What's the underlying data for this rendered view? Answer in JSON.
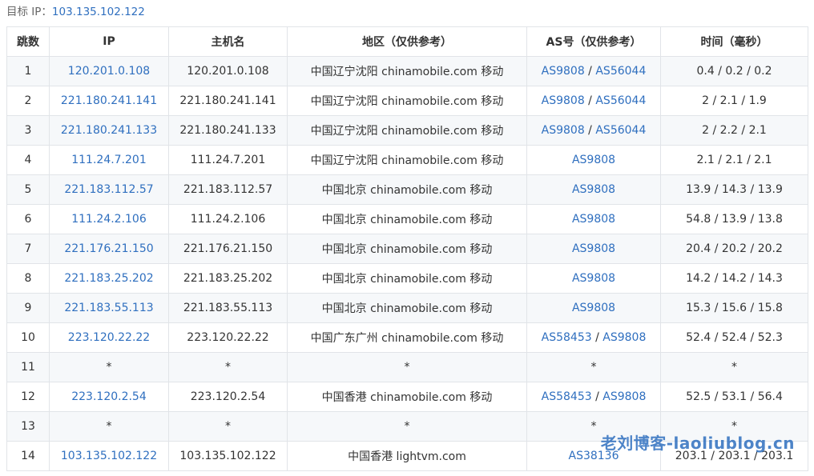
{
  "target": {
    "label": "目标 IP：",
    "ip": "103.135.102.122"
  },
  "table": {
    "headers": [
      "跳数",
      "IP",
      "主机名",
      "地区（仅供参考）",
      "AS号（仅供参考）",
      "时间（毫秒）"
    ],
    "rows": [
      {
        "hop": "1",
        "ip": "120.201.0.108",
        "host": "120.201.0.108",
        "region": "中国辽宁沈阳 chinamobile.com 移动",
        "as": [
          "AS9808",
          "AS56044"
        ],
        "time": "0.4 / 0.2 / 0.2"
      },
      {
        "hop": "2",
        "ip": "221.180.241.141",
        "host": "221.180.241.141",
        "region": "中国辽宁沈阳 chinamobile.com 移动",
        "as": [
          "AS9808",
          "AS56044"
        ],
        "time": "2 / 2.1 / 1.9"
      },
      {
        "hop": "3",
        "ip": "221.180.241.133",
        "host": "221.180.241.133",
        "region": "中国辽宁沈阳 chinamobile.com 移动",
        "as": [
          "AS9808",
          "AS56044"
        ],
        "time": "2 / 2.2 / 2.1"
      },
      {
        "hop": "4",
        "ip": "111.24.7.201",
        "host": "111.24.7.201",
        "region": "中国辽宁沈阳 chinamobile.com 移动",
        "as": [
          "AS9808"
        ],
        "time": "2.1 / 2.1 / 2.1"
      },
      {
        "hop": "5",
        "ip": "221.183.112.57",
        "host": "221.183.112.57",
        "region": "中国北京 chinamobile.com 移动",
        "as": [
          "AS9808"
        ],
        "time": "13.9 / 14.3 / 13.9"
      },
      {
        "hop": "6",
        "ip": "111.24.2.106",
        "host": "111.24.2.106",
        "region": "中国北京 chinamobile.com 移动",
        "as": [
          "AS9808"
        ],
        "time": "54.8 / 13.9 / 13.8"
      },
      {
        "hop": "7",
        "ip": "221.176.21.150",
        "host": "221.176.21.150",
        "region": "中国北京 chinamobile.com 移动",
        "as": [
          "AS9808"
        ],
        "time": "20.4 / 20.2 / 20.2"
      },
      {
        "hop": "8",
        "ip": "221.183.25.202",
        "host": "221.183.25.202",
        "region": "中国北京 chinamobile.com 移动",
        "as": [
          "AS9808"
        ],
        "time": "14.2 / 14.2 / 14.3"
      },
      {
        "hop": "9",
        "ip": "221.183.55.113",
        "host": "221.183.55.113",
        "region": "中国北京 chinamobile.com 移动",
        "as": [
          "AS9808"
        ],
        "time": "15.3 / 15.6 / 15.8"
      },
      {
        "hop": "10",
        "ip": "223.120.22.22",
        "host": "223.120.22.22",
        "region": "中国广东广州 chinamobile.com 移动",
        "as": [
          "AS58453",
          "AS9808"
        ],
        "time": "52.4 / 52.4 / 52.3"
      },
      {
        "hop": "11",
        "ip": "*",
        "host": "*",
        "region": "*",
        "as": [
          "*"
        ],
        "time": "*"
      },
      {
        "hop": "12",
        "ip": "223.120.2.54",
        "host": "223.120.2.54",
        "region": "中国香港 chinamobile.com 移动",
        "as": [
          "AS58453",
          "AS9808"
        ],
        "time": "52.5 / 53.1 / 56.4"
      },
      {
        "hop": "13",
        "ip": "*",
        "host": "*",
        "region": "*",
        "as": [
          "*"
        ],
        "time": "*"
      },
      {
        "hop": "14",
        "ip": "103.135.102.122",
        "host": "103.135.102.122",
        "region": "中国香港 lightvm.com",
        "as": [
          "AS38136"
        ],
        "time": "203.1 / 203.1 / 203.1"
      }
    ]
  },
  "watermark": "老刘博客-laoliublog.cn",
  "colors": {
    "link": "#2f6fbf",
    "border": "#e1e4e8",
    "stripe": "#f6f8fa",
    "text": "#333333"
  }
}
